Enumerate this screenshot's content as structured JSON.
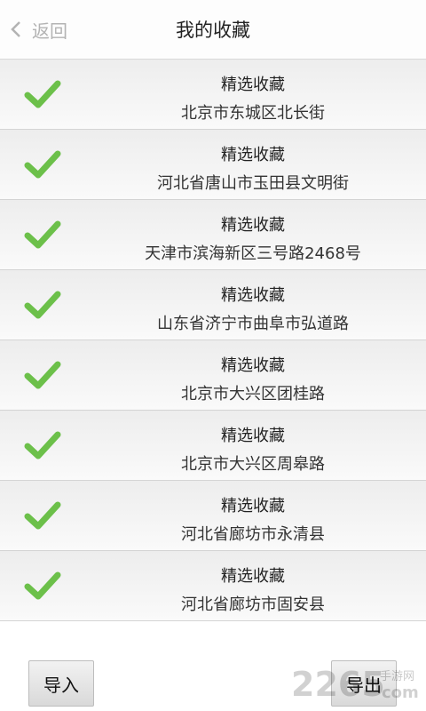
{
  "header": {
    "back_label": "返回",
    "title": "我的收藏"
  },
  "favorites": [
    {
      "name": "精选收藏",
      "address": "北京市东城区北长街",
      "checked": true
    },
    {
      "name": "精选收藏",
      "address": "河北省唐山市玉田县文明街",
      "checked": true
    },
    {
      "name": "精选收藏",
      "address": "天津市滨海新区三号路2468号",
      "checked": true
    },
    {
      "name": "精选收藏",
      "address": "山东省济宁市曲阜市弘道路",
      "checked": true
    },
    {
      "name": "精选收藏",
      "address": "北京市大兴区团桂路",
      "checked": true
    },
    {
      "name": "精选收藏",
      "address": "北京市大兴区周皋路",
      "checked": true
    },
    {
      "name": "精选收藏",
      "address": "河北省廊坊市永清县",
      "checked": true
    },
    {
      "name": "精选收藏",
      "address": "河北省廊坊市固安县",
      "checked": true
    }
  ],
  "footer": {
    "import_label": "导入",
    "export_label": "导出"
  },
  "watermark": {
    "digits": "2265",
    "line1": "手游网",
    "line2": "com"
  },
  "colors": {
    "check": "#6cc04a",
    "back_text": "#b3b3b3"
  }
}
